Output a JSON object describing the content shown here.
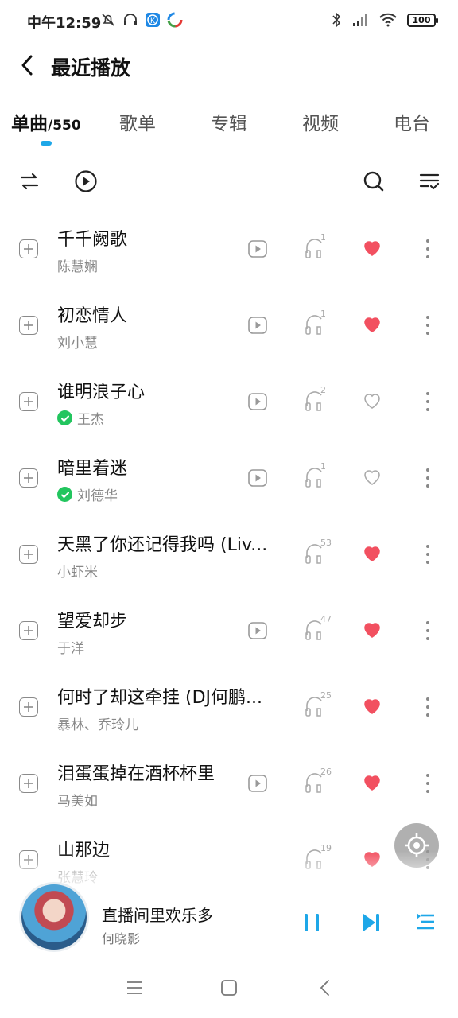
{
  "status_bar": {
    "time": "中午12:59",
    "battery": "100"
  },
  "header": {
    "title": "最近播放"
  },
  "tabs": [
    {
      "label": "单曲",
      "count": "/550"
    },
    {
      "label": "歌单"
    },
    {
      "label": "专辑"
    },
    {
      "label": "视频"
    },
    {
      "label": "电台"
    }
  ],
  "colors": {
    "accent": "#1ea7e8",
    "heart_red": "#f25060",
    "verified_green": "#22c55e"
  },
  "songs": [
    {
      "title": "千千阙歌",
      "artist": "陈慧娴",
      "listens": "1",
      "liked": true,
      "verified": false,
      "mv": true
    },
    {
      "title": "初恋情人",
      "artist": "刘小慧",
      "listens": "1",
      "liked": true,
      "verified": false,
      "mv": true
    },
    {
      "title": "谁明浪子心",
      "artist": "王杰",
      "listens": "2",
      "liked": false,
      "verified": true,
      "mv": true
    },
    {
      "title": "暗里着迷",
      "artist": "刘德华",
      "listens": "1",
      "liked": false,
      "verified": true,
      "mv": true
    },
    {
      "title": "天黑了你还记得我吗 (Liv...",
      "artist": "小虾米",
      "listens": "53",
      "liked": true,
      "verified": false,
      "mv": false
    },
    {
      "title": "望爱却步",
      "artist": "于洋",
      "listens": "47",
      "liked": true,
      "verified": false,
      "mv": true
    },
    {
      "title": "何时了却这牵挂 (DJ何鹏...",
      "artist": "暴林、乔玲儿",
      "listens": "25",
      "liked": true,
      "verified": false,
      "mv": false
    },
    {
      "title": "泪蛋蛋掉在酒杯杯里",
      "artist": "马美如",
      "listens": "26",
      "liked": true,
      "verified": false,
      "mv": true
    },
    {
      "title": "山那边",
      "artist": "张慧玲",
      "listens": "19",
      "liked": true,
      "verified": false,
      "mv": false
    }
  ],
  "player": {
    "title": "直播间里欢乐多",
    "artist": "何晓影"
  }
}
